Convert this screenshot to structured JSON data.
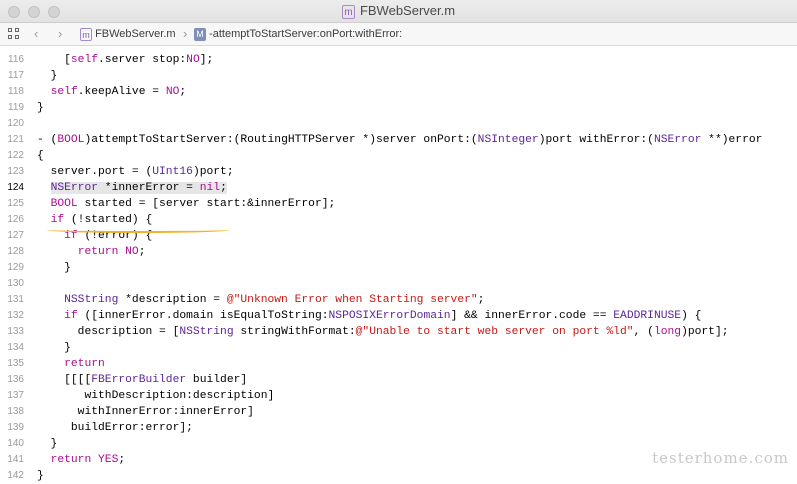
{
  "window": {
    "title": "FBWebServer.m"
  },
  "jumpbar": {
    "file": "FBWebServer.m",
    "method": "-attemptToStartServer:onPort:withError:"
  },
  "editor": {
    "current_line": 124,
    "lines": [
      {
        "n": "116",
        "code": "    [self.server stop:NO];"
      },
      {
        "n": "117",
        "code": "  }"
      },
      {
        "n": "118",
        "code": "  self.keepAlive = NO;"
      },
      {
        "n": "119",
        "code": "}"
      },
      {
        "n": "120",
        "code": ""
      },
      {
        "n": "121",
        "code": "- (BOOL)attemptToStartServer:(RoutingHTTPServer *)server onPort:(NSInteger)port withError:(NSError **)error"
      },
      {
        "n": "122",
        "code": "{"
      },
      {
        "n": "123",
        "code": "  server.port = (UInt16)port;"
      },
      {
        "n": "124",
        "code": "  NSError *innerError = nil;"
      },
      {
        "n": "125",
        "code": "  BOOL started = [server start:&innerError];"
      },
      {
        "n": "126",
        "code": "  if (!started) {"
      },
      {
        "n": "127",
        "code": "    if (!error) {"
      },
      {
        "n": "128",
        "code": "      return NO;"
      },
      {
        "n": "129",
        "code": "    }"
      },
      {
        "n": "130",
        "code": ""
      },
      {
        "n": "131",
        "code": "    NSString *description = @\"Unknown Error when Starting server\";"
      },
      {
        "n": "132",
        "code": "    if ([innerError.domain isEqualToString:NSPOSIXErrorDomain] && innerError.code == EADDRINUSE) {"
      },
      {
        "n": "133",
        "code": "      description = [NSString stringWithFormat:@\"Unable to start web server on port %ld\", (long)port];"
      },
      {
        "n": "134",
        "code": "    }"
      },
      {
        "n": "135",
        "code": "    return"
      },
      {
        "n": "136",
        "code": "    [[[[FBErrorBuilder builder]"
      },
      {
        "n": "137",
        "code": "       withDescription:description]"
      },
      {
        "n": "138",
        "code": "      withInnerError:innerError]"
      },
      {
        "n": "139",
        "code": "     buildError:error];"
      },
      {
        "n": "140",
        "code": "  }"
      },
      {
        "n": "141",
        "code": "  return YES;"
      },
      {
        "n": "142",
        "code": "}"
      }
    ]
  },
  "watermark": "testerhome.com"
}
